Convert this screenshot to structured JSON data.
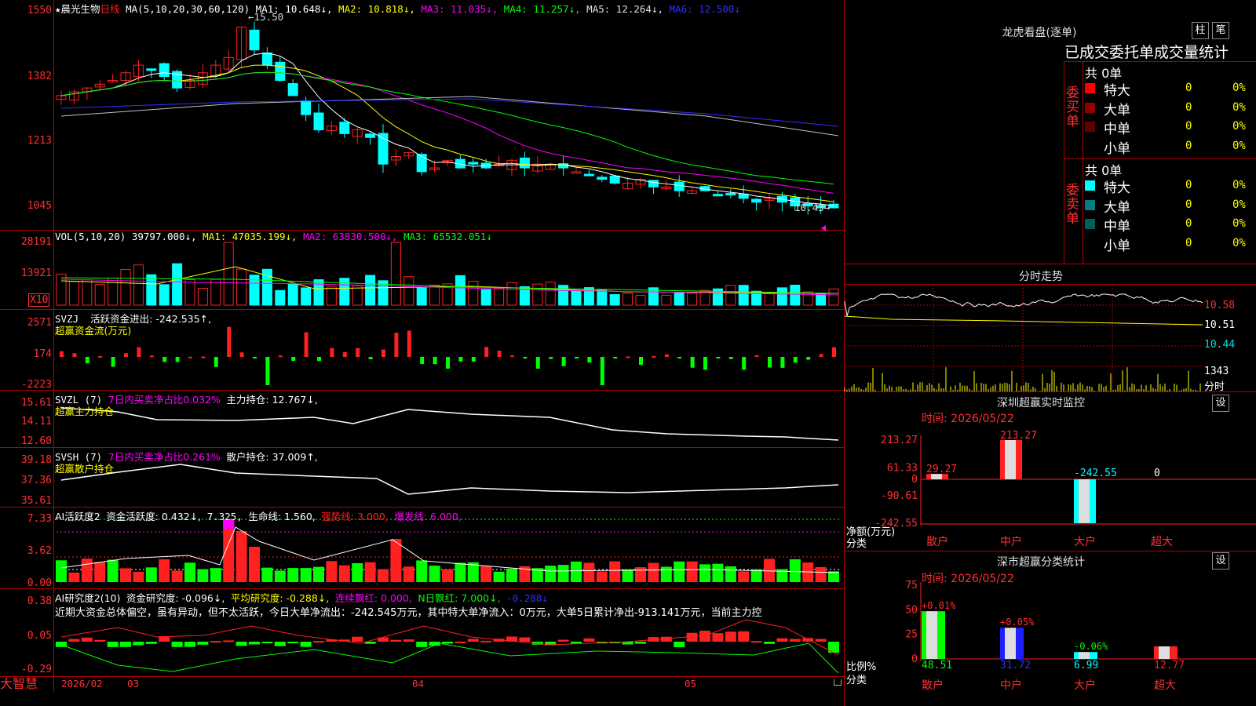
{
  "app": {
    "brand": "大智慧"
  },
  "main_chart": {
    "title_star": "★",
    "stock_name": "晨光生物",
    "period": "日线",
    "ma_header": "MA(5,10,20,30,60,120)",
    "ma1": "MA1: 10.648↓,",
    "ma2": "MA2: 10.818↓,",
    "ma3": "MA3: 11.035↓,",
    "ma4": "MA4: 11.257↓,",
    "ma5": "MA5: 12.264↓,",
    "ma6": "MA6: 12.500↓",
    "y_ticks": [
      "1550",
      "1382",
      "1213",
      "1045"
    ],
    "high_label": "15.50",
    "low_label": "10.43",
    "colors": {
      "up": "#ff2020",
      "down": "#00ffff",
      "ma1": "#ffffff",
      "ma2": "#ffff00",
      "ma3": "#ff00ff",
      "ma4": "#00ff00",
      "ma5": "#c0c0c0",
      "ma6": "#3030ff"
    }
  },
  "vol_panel": {
    "header": "VOL(5,10,20)",
    "value": "39797.000↓,",
    "ma1": "MA1: 47035.199↓,",
    "ma2": "MA2: 63830.500↓,",
    "ma3": "MA3: 65532.051↓",
    "y_ticks": [
      "28191",
      "13921",
      "X10"
    ]
  },
  "svzj_panel": {
    "header": "SVZJ",
    "label": "活跃资金进出: -242.535↑,",
    "subtitle": "超赢资金流(万元)",
    "y_ticks": [
      "2571",
      "174",
      "-2223"
    ]
  },
  "svzl_panel": {
    "header": "SVZL (7)",
    "ratio": "7日内买卖净占比0.032%",
    "main": "主力持仓: 12.767↓,",
    "subtitle": "超赢主力持仓",
    "y_ticks": [
      "15.61",
      "14.11",
      "12.60"
    ]
  },
  "svsh_panel": {
    "header": "SVSH (7)",
    "ratio": "7日内买卖净占比0.261%",
    "main": "散户持仓: 37.009↑,",
    "subtitle": "超赢散户持仓",
    "y_ticks": [
      "39.18",
      "37.36",
      "35.61"
    ]
  },
  "ai_active_panel": {
    "header": "AI活跃度2",
    "a": "资金活跃度: 0.432↓,",
    "b": "7.325,",
    "c": "生命线: 1.560,",
    "d": "强势线: 3.000,",
    "e": "爆发线: 6.000,",
    "y_ticks": [
      "7.33",
      "3.62",
      "0.00"
    ]
  },
  "ai_research_panel": {
    "header": "AI研究度2(10)",
    "a": "资金研究度: -0.096↓,",
    "b": "平均研究度: -0.288↓,",
    "c": "连续飘红: 0.000,",
    "d": "N日飘红: 7.000↓,",
    "e": "-0.288↓",
    "note": "近期大资金总体偏空，虽有异动，但不太活跃，今日大单净流出：-242.545万元，其中特大单净流入：0万元，大单5日累计净出-913.141万元，当前主力控",
    "y_ticks": [
      "0.38",
      "0.05",
      "-0.29"
    ]
  },
  "x_axis": {
    "labels": [
      "2026/02",
      "03",
      "04",
      "05"
    ]
  },
  "longhu": {
    "title": "龙虎看盘(逐单)",
    "btn_zhu": "柱",
    "btn_bi": "笔",
    "tabs": [
      "已成交",
      "委托单",
      "成交量",
      "统计"
    ],
    "buy_label": "委买单",
    "sell_label": "委卖单",
    "buy_total": "共 0单",
    "sell_total": "共 0单",
    "rows_buy": [
      {
        "name": "特大",
        "count": "0",
        "pct": "0%",
        "color": "#ff0000"
      },
      {
        "name": "大单",
        "count": "0",
        "pct": "0%",
        "color": "#900000"
      },
      {
        "name": "中单",
        "count": "0",
        "pct": "0%",
        "color": "#600000"
      },
      {
        "name": "小单",
        "count": "0",
        "pct": "0%",
        "color": "#000000"
      }
    ],
    "rows_sell": [
      {
        "name": "特大",
        "count": "0",
        "pct": "0%",
        "color": "#00ffff"
      },
      {
        "name": "大单",
        "count": "0",
        "pct": "0%",
        "color": "#008080"
      },
      {
        "name": "中单",
        "count": "0",
        "pct": "0%",
        "color": "#006060"
      },
      {
        "name": "小单",
        "count": "0",
        "pct": "0%",
        "color": "#000000"
      }
    ]
  },
  "intraday": {
    "title": "分时走势",
    "price_ticks": [
      "10.58",
      "10.51",
      "10.44"
    ],
    "vol_tick": "1343",
    "vol_unit": "分时"
  },
  "monitor": {
    "title": "深圳超赢实时监控",
    "btn": "设",
    "time": "时间: 2026/05/22",
    "y_ticks": [
      "213.27",
      "61.33",
      "0",
      "-90.61",
      "-242.55"
    ],
    "unit": "净额(万元)",
    "cat_label": "分类",
    "categories": [
      "散户",
      "中户",
      "大户",
      "超大"
    ],
    "values": [
      29.27,
      213.27,
      -242.55,
      0
    ],
    "value_labels": [
      "29.27",
      "213.27",
      "-242.55",
      "0"
    ]
  },
  "classify": {
    "title": "深市超赢分类统计",
    "btn": "设",
    "time": "时间: 2026/05/22",
    "y_ticks": [
      "75",
      "50",
      "25",
      "0"
    ],
    "unit": "比例%",
    "cat_label": "分类",
    "categories": [
      "散户",
      "中户",
      "大户",
      "超大"
    ],
    "values": [
      48.51,
      31.72,
      6.99,
      12.77
    ],
    "value_labels": [
      "48.51",
      "31.72",
      "6.99",
      "12.77"
    ],
    "change_labels": [
      "+0.01%",
      "+0.05%",
      "-0.06%",
      ""
    ],
    "colors": [
      "#00ff00",
      "#2020ff",
      "#00ffff",
      "#ff2020"
    ]
  }
}
